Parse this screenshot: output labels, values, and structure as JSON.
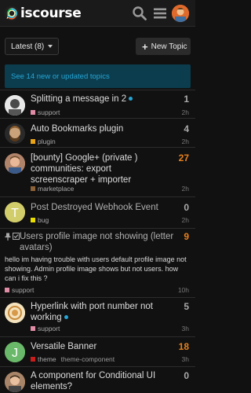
{
  "header": {
    "logo_text": "iscourse",
    "icons": [
      "search-icon",
      "menu-icon",
      "user-avatar"
    ]
  },
  "controls": {
    "filter_label": "Latest (8)",
    "new_topic_label": "New Topic"
  },
  "banner": {
    "text": "See 14 new or updated topics"
  },
  "topics": [
    {
      "title": "Splitting a message in 2",
      "count": "1",
      "time": "2h",
      "category": "support",
      "category_color": "#e08ca6",
      "tags": "",
      "unread_dot": true
    },
    {
      "title": "Auto Bookmarks plugin",
      "count": "4",
      "time": "2h",
      "category": "plugin",
      "category_color": "#e8a317",
      "tags": "",
      "unread_dot": false
    },
    {
      "title": "[bounty] Google+ (private ) communities: export screenscraper + importer",
      "count": "27",
      "time": "2h",
      "category": "marketplace",
      "category_color": "#8c6238",
      "tags": "",
      "unread_dot": false
    },
    {
      "title": "Post Destroyed Webhook Event",
      "count": "0",
      "time": "2h",
      "category": "bug",
      "category_color": "#e9dd00",
      "tags": "",
      "unread_dot": false
    },
    {
      "title": "Users profile image not showing (letter avatars)",
      "count": "9",
      "time": "10h",
      "category": "support",
      "category_color": "#e08ca6",
      "tags": "",
      "unread_dot": false,
      "excerpt": "hello im having trouble with users default profile image not showing. Admin profile image shows but not users. how can i fix this ?"
    },
    {
      "title": "Hyperlink with port number not working",
      "count": "5",
      "time": "3h",
      "category": "support",
      "category_color": "#e08ca6",
      "tags": "",
      "unread_dot": true
    },
    {
      "title": "Versatile Banner",
      "count": "18",
      "time": "3h",
      "category": "theme",
      "category_color": "#c81d1d",
      "tags": "theme-component",
      "unread_dot": false
    },
    {
      "title": "A component for Conditional UI elements?",
      "count": "0",
      "time": "",
      "category": "",
      "category_color": "",
      "tags": "",
      "unread_dot": false
    }
  ],
  "colors": {
    "accent_blue": "#26a6d6",
    "hot_orange": "#e8801c",
    "background": "#111111"
  }
}
